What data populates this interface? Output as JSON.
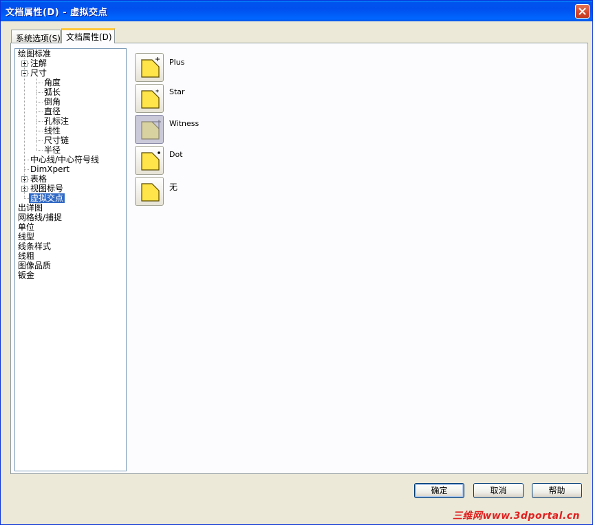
{
  "window": {
    "title": "文档属性(D) - 虚拟交点"
  },
  "tabs": [
    {
      "label": "系统选项(S)",
      "active": false
    },
    {
      "label": "文档属性(D)",
      "active": true
    }
  ],
  "tree": {
    "items": [
      {
        "label": "绘图标准",
        "level": 0,
        "expander": null,
        "selected": false
      },
      {
        "label": "注解",
        "level": 1,
        "expander": "plus",
        "selected": false
      },
      {
        "label": "尺寸",
        "level": 1,
        "expander": "minus",
        "selected": false
      },
      {
        "label": "角度",
        "level": 2,
        "expander": null,
        "selected": false
      },
      {
        "label": "弧长",
        "level": 2,
        "expander": null,
        "selected": false
      },
      {
        "label": "倒角",
        "level": 2,
        "expander": null,
        "selected": false
      },
      {
        "label": "直径",
        "level": 2,
        "expander": null,
        "selected": false
      },
      {
        "label": "孔标注",
        "level": 2,
        "expander": null,
        "selected": false
      },
      {
        "label": "线性",
        "level": 2,
        "expander": null,
        "selected": false
      },
      {
        "label": "尺寸链",
        "level": 2,
        "expander": null,
        "selected": false
      },
      {
        "label": "半径",
        "level": 2,
        "expander": null,
        "selected": false
      },
      {
        "label": "中心线/中心符号线",
        "level": 1,
        "expander": null,
        "selected": false
      },
      {
        "label": "DimXpert",
        "level": 1,
        "expander": null,
        "selected": false
      },
      {
        "label": "表格",
        "level": 1,
        "expander": "plus",
        "selected": false
      },
      {
        "label": "视图标号",
        "level": 1,
        "expander": "plus",
        "selected": false
      },
      {
        "label": "虚拟交点",
        "level": 1,
        "expander": null,
        "selected": true
      },
      {
        "label": "出详图",
        "level": 0,
        "expander": null,
        "selected": false
      },
      {
        "label": "网格线/捕捉",
        "level": 0,
        "expander": null,
        "selected": false
      },
      {
        "label": "单位",
        "level": 0,
        "expander": null,
        "selected": false
      },
      {
        "label": "线型",
        "level": 0,
        "expander": null,
        "selected": false
      },
      {
        "label": "线条样式",
        "level": 0,
        "expander": null,
        "selected": false
      },
      {
        "label": "线粗",
        "level": 0,
        "expander": null,
        "selected": false
      },
      {
        "label": "图像品质",
        "level": 0,
        "expander": null,
        "selected": false
      },
      {
        "label": "钣金",
        "level": 0,
        "expander": null,
        "selected": false
      }
    ]
  },
  "options": [
    {
      "label": "Plus",
      "icon": "plus-corner-icon",
      "selected": false
    },
    {
      "label": "Star",
      "icon": "star-corner-icon",
      "selected": false
    },
    {
      "label": "Witness",
      "icon": "witness-corner-icon",
      "selected": true
    },
    {
      "label": "Dot",
      "icon": "dot-corner-icon",
      "selected": false
    },
    {
      "label": "无",
      "icon": "none-corner-icon",
      "selected": false
    }
  ],
  "buttons": {
    "ok": "确定",
    "cancel": "取消",
    "help": "帮助"
  },
  "watermark": "三维网www.3dportal.cn",
  "colors": {
    "titlebar": "#0055E5",
    "selection": "#316AC5",
    "icon_fill": "#FFE54A",
    "active_tab_accent": "#FFC83C"
  }
}
